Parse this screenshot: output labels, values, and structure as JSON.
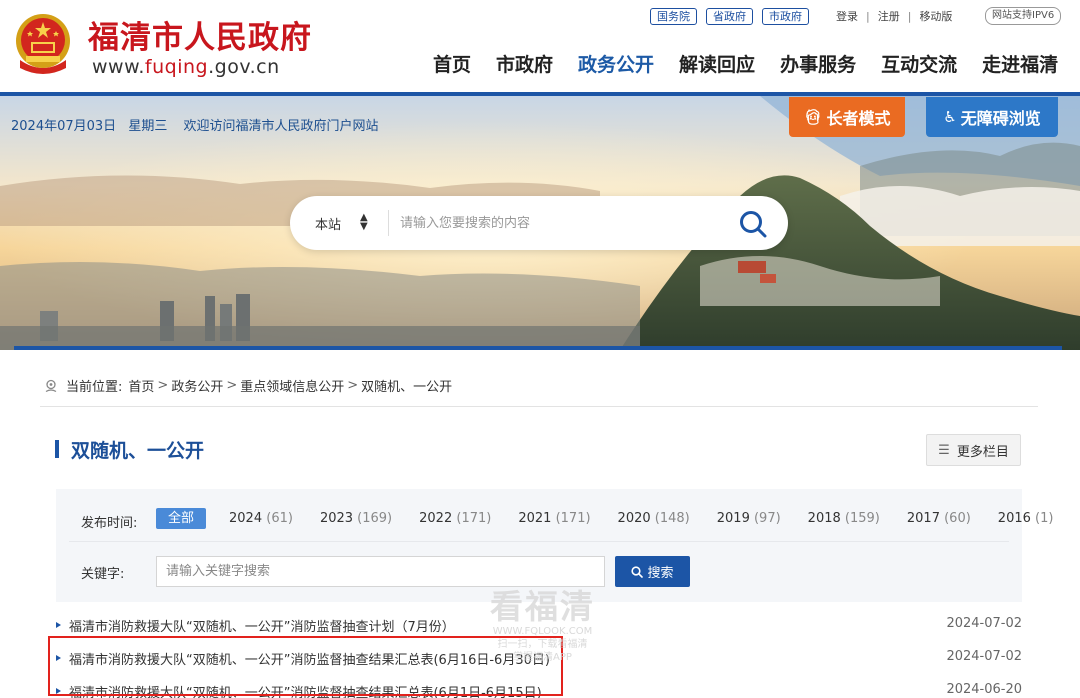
{
  "site": {
    "name": "福清市人民政府",
    "url_prefix": "www.",
    "url_domain": "fuqing",
    "url_suffix": ".gov.cn",
    "brand_red": "#c8161d",
    "brand_blue": "#1c55a6"
  },
  "top_links": {
    "gov": [
      "国务院",
      "省政府",
      "市政府"
    ],
    "login": "登录",
    "register": "注册",
    "mobile": "移动版",
    "separator": "|",
    "ipv6": "网站支持IPV6"
  },
  "nav": [
    "首页",
    "市政府",
    "政务公开",
    "解读回应",
    "办事服务",
    "互动交流",
    "走进福清"
  ],
  "nav_active_index": 2,
  "banner": {
    "date": "2024年07月03日",
    "weekday": "星期三",
    "welcome": "欢迎访问福清市人民政府门户网站",
    "elder_mode": "长者模式",
    "accessible": "无障碍浏览",
    "elder_color": "#ea6b22",
    "accessible_color": "#2d78c8"
  },
  "search": {
    "scope": "本站",
    "placeholder": "请输入您要搜索的内容"
  },
  "breadcrumb": {
    "prefix": "当前位置:",
    "items": [
      "首页",
      "政务公开",
      "重点领域信息公开",
      "双随机、一公开"
    ],
    "separator": ">"
  },
  "column": {
    "title": "双随机、一公开",
    "more": "更多栏目"
  },
  "filter": {
    "time_label": "发布时间:",
    "all_label": "全部",
    "years": [
      {
        "year": "2024",
        "count": "(61)"
      },
      {
        "year": "2023",
        "count": "(169)"
      },
      {
        "year": "2022",
        "count": "(171)"
      },
      {
        "year": "2021",
        "count": "(171)"
      },
      {
        "year": "2020",
        "count": "(148)"
      },
      {
        "year": "2019",
        "count": "(97)"
      },
      {
        "year": "2018",
        "count": "(159)"
      },
      {
        "year": "2017",
        "count": "(60)"
      },
      {
        "year": "2016",
        "count": "(1)"
      }
    ],
    "keyword_label": "关键字:",
    "keyword_placeholder": "请输入关键字搜索",
    "search_button": "搜索"
  },
  "articles": [
    {
      "title": "福清市消防救援大队“双随机、一公开”消防监督抽查计划（7月份）",
      "date": "2024-07-02"
    },
    {
      "title": "福清市消防救援大队“双随机、一公开”消防监督抽查结果汇总表(6月16日-6月30日)",
      "date": "2024-07-02"
    },
    {
      "title": "福清市消防救援大队“双随机、一公开”消防监督抽查结果汇总表(6月1日-6月15日)",
      "date": "2024-06-20"
    }
  ],
  "watermark": {
    "big": "看福清",
    "line1": "WWW.FQLOOK.COM",
    "line2": "扫一扫，下载看福清",
    "line3": "掌握福清APP"
  },
  "icons": {
    "emblem": "national-emblem-icon",
    "elder": "elder-person-icon",
    "accessible": "wheelchair-icon",
    "search": "search-icon",
    "pin": "location-pin-icon",
    "more": "list-icon"
  }
}
